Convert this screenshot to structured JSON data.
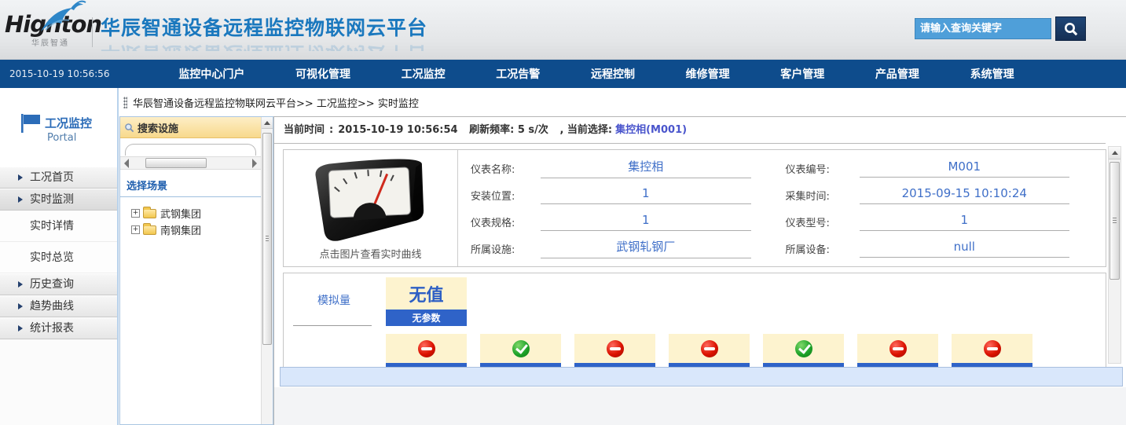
{
  "header": {
    "logo": "Hignton",
    "logo_sub": "华辰智通",
    "title": "华辰智通设备远程监控物联网云平台",
    "search_placeholder": "请输入查询关键字"
  },
  "nav": {
    "timestamp": "2015-10-19 10:56:56",
    "items": [
      "监控中心门户",
      "可视化管理",
      "工况监控",
      "工况告警",
      "远程控制",
      "维修管理",
      "客户管理",
      "产品管理",
      "系统管理"
    ]
  },
  "sidebar": {
    "title": "工况监控",
    "subtitle": "Portal",
    "items": [
      {
        "label": "工况首页"
      },
      {
        "label": "实时监测"
      },
      {
        "label": "实时详情"
      },
      {
        "label": "实时总览"
      },
      {
        "label": "历史查询"
      },
      {
        "label": "趋势曲线"
      },
      {
        "label": "统计报表"
      }
    ]
  },
  "breadcrumb": "华辰智通设备远程监控物联网云平台>> 工况监控>> 实时监控",
  "search_panel": {
    "header": "搜索设施",
    "tree_title": "选择场景",
    "tree": [
      "武钢集团",
      "南钢集团"
    ]
  },
  "main": {
    "time_label": "当前时间",
    "time_sep": ":",
    "time_value": "2015-10-19 10:56:54",
    "refresh_label": "刷新频率: ",
    "refresh_value": "5 s/次",
    "select_label": ", 当前选择:",
    "select_value": "集控相(M001)",
    "meter_caption": "点击图片查看实时曲线",
    "fields_left": [
      {
        "label": "仪表名称:",
        "value": "集控相"
      },
      {
        "label": "安装位置:",
        "value": "1"
      },
      {
        "label": "仪表规格:",
        "value": "1"
      },
      {
        "label": "所属设施:",
        "value": "武钢轧钢厂"
      }
    ],
    "fields_right": [
      {
        "label": "仪表编号:",
        "value": "M001"
      },
      {
        "label": "采集时间:",
        "value": "2015-09-15 10:10:24"
      },
      {
        "label": "仪表型号:",
        "value": "1"
      },
      {
        "label": "所属设备:",
        "value": "null"
      }
    ],
    "analog_label": "模拟量",
    "no_value": "无值",
    "no_param": "无参数",
    "statuses": [
      "blocked",
      "ok",
      "blocked",
      "blocked",
      "ok",
      "blocked",
      "blocked"
    ]
  },
  "icons": {
    "search": "magnifier",
    "status_ok": "green-check-circle",
    "status_blocked": "red-no-entry-circle",
    "portal": "blue-flag",
    "tree_expand": "plus-box",
    "tree_node": "yellow-folder"
  },
  "colors": {
    "nav_blue": "#0e4c8c",
    "title_blue": "#1a78be",
    "accent_blue": "#2f63c8",
    "value_blue": "#3f6fc8",
    "selection_purple": "#4a55cc",
    "panel_header_yellow": "#f8d98c",
    "card_cream": "#fdf3cf",
    "band_blue": "#d9e7fb",
    "search_input_blue": "#4f9fd9"
  }
}
